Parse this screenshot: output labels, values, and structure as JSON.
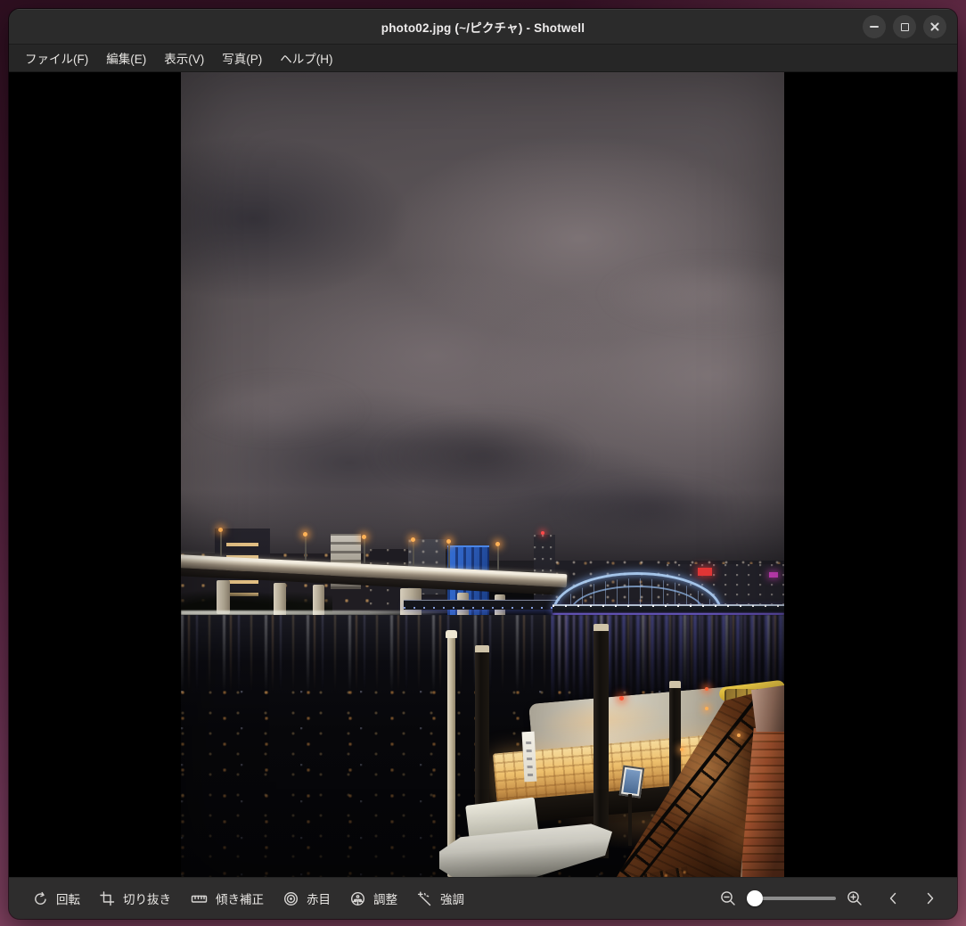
{
  "window": {
    "title": "photo02.jpg (~/ピクチャ) - Shotwell",
    "controls": [
      {
        "id": "minimize",
        "icon": "minimize-icon"
      },
      {
        "id": "maximize",
        "icon": "maximize-icon"
      },
      {
        "id": "close",
        "icon": "close-icon"
      }
    ]
  },
  "menubar": {
    "items": [
      {
        "id": "file",
        "label": "ファイル(F)"
      },
      {
        "id": "edit",
        "label": "編集(E)"
      },
      {
        "id": "view",
        "label": "表示(V)"
      },
      {
        "id": "photo",
        "label": "写真(P)"
      },
      {
        "id": "help",
        "label": "ヘルプ(H)"
      }
    ]
  },
  "toolbar": {
    "tools": [
      {
        "id": "rotate",
        "label": "回転",
        "icon": "rotate-icon"
      },
      {
        "id": "crop",
        "label": "切り抜き",
        "icon": "crop-icon"
      },
      {
        "id": "straighten",
        "label": "傾き補正",
        "icon": "straighten-icon"
      },
      {
        "id": "redeye",
        "label": "赤目",
        "icon": "redeye-icon"
      },
      {
        "id": "adjust",
        "label": "調整",
        "icon": "adjust-icon"
      },
      {
        "id": "enhance",
        "label": "強調",
        "icon": "enhance-icon"
      }
    ],
    "zoom": {
      "out_icon": "zoom-out-icon",
      "in_icon": "zoom-in-icon",
      "handle_position": "left"
    },
    "nav": [
      {
        "id": "previous",
        "icon": "chevron-left-icon"
      },
      {
        "id": "next",
        "icon": "chevron-right-icon"
      }
    ]
  },
  "photo_view": {
    "description": "Night photograph of a Tokyo river: overcast gray sky, elevated expressway with orange street lamps on the left, blue illuminated arch bridge on the right, lit yakatabune houseboat and small white boat moored by a brick riverside walkway, city lights reflecting in dark water.",
    "colors": {
      "sky": "#5d5659",
      "water": "#08080b",
      "bridge_glow": "#9cc4ee",
      "boat_warm": "#edbf6c",
      "brick": "#a8542f",
      "wallpaper_top": "#2e0f20",
      "wallpaper_bottom": "#8c4a66",
      "titlebar": "#2b2b2b",
      "toolbar": "#2e2d2d"
    }
  }
}
